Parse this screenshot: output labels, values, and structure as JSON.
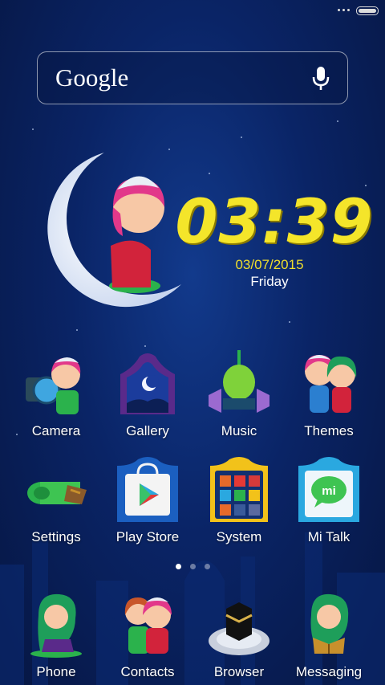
{
  "search": {
    "logo": "Google"
  },
  "clock": {
    "time": "03:39",
    "date": "03/07/2015",
    "day": "Friday"
  },
  "apps_row1": [
    {
      "label": "Camera"
    },
    {
      "label": "Gallery"
    },
    {
      "label": "Music"
    },
    {
      "label": "Themes"
    }
  ],
  "apps_row2": [
    {
      "label": "Settings"
    },
    {
      "label": "Play Store"
    },
    {
      "label": "System"
    },
    {
      "label": "Mi Talk"
    }
  ],
  "dock": [
    {
      "label": "Phone"
    },
    {
      "label": "Contacts"
    },
    {
      "label": "Browser"
    },
    {
      "label": "Messaging"
    }
  ],
  "pager": {
    "pages": 3,
    "active": 1
  },
  "colors": {
    "clock": "#f4e52a",
    "background": "#0a2466"
  }
}
